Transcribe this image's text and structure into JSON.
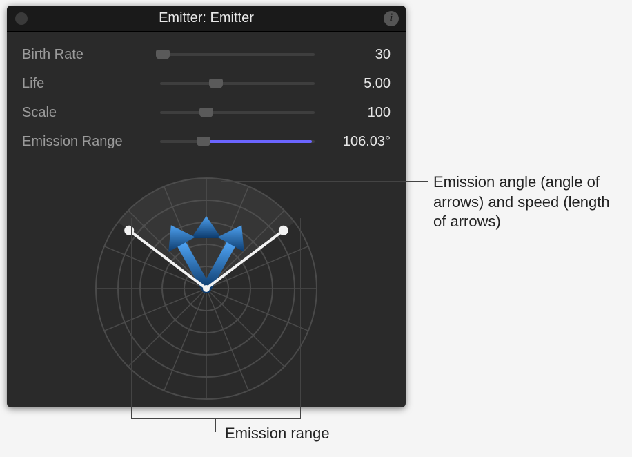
{
  "header": {
    "title": "Emitter: Emitter",
    "info_glyph": "i"
  },
  "params": [
    {
      "label": "Birth Rate",
      "value": "30",
      "pos": 2,
      "fill": 0,
      "color": "#6b65ff"
    },
    {
      "label": "Life",
      "value": "5.00",
      "pos": 36,
      "fill": 0,
      "color": "#6b65ff"
    },
    {
      "label": "Scale",
      "value": "100",
      "pos": 30,
      "fill": 0,
      "color": "#6b65ff"
    },
    {
      "label": "Emission Range",
      "value": "106.03°",
      "pos": 28,
      "fill": 70,
      "color": "#6b65ff"
    }
  ],
  "radar": {
    "range_deg": 106.03,
    "arrow_len": 105,
    "range_line_len": 140,
    "rings": [
      32,
      64,
      96,
      128,
      160
    ]
  },
  "callouts": {
    "angle_speed": "Emission angle (angle of arrows) and speed (length of arrows)",
    "range": "Emission range"
  }
}
